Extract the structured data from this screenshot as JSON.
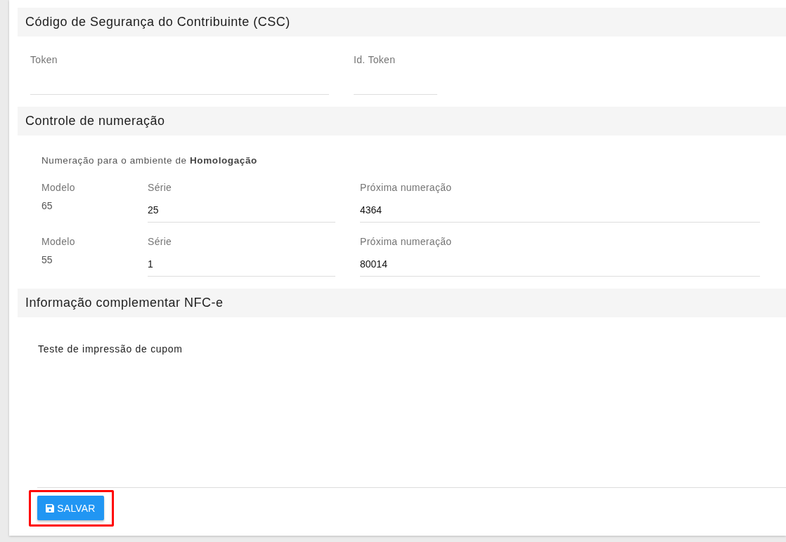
{
  "csc_section": {
    "title": "Código de Segurança do Contribuinte (CSC)",
    "fields": [
      {
        "label": "Token"
      },
      {
        "label": "Id. Token"
      }
    ]
  },
  "numbering_section": {
    "title": "Controle de numeração",
    "environment_note": "Numeração para o ambiente de **Homologação**",
    "rows": [
      {
        "model_label": "Modelo",
        "model": "65",
        "series_label": "Série",
        "series": "25",
        "next_label": "Próxima numeração",
        "next": "4364"
      },
      {
        "model_label": "Modelo",
        "model": "55",
        "series_label": "Série",
        "series": "1",
        "next_label": "Próxima numeração",
        "next": "80014"
      }
    ]
  },
  "complement_section": {
    "title": "Informação complementar NFC-e",
    "text": "Teste de impressão de cupom"
  },
  "save_button": {
    "label": "SALVAR",
    "highlighted": true
  }
}
